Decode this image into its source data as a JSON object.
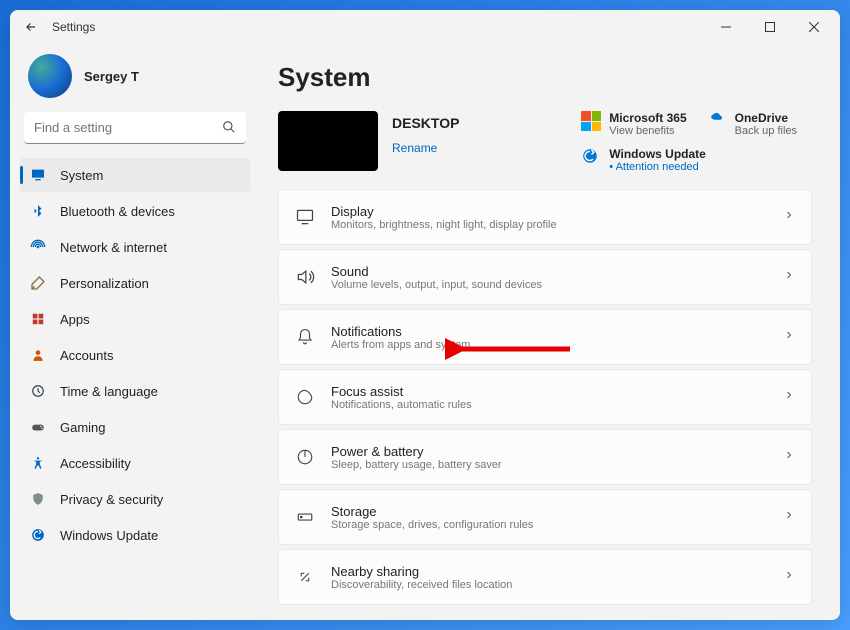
{
  "titlebar": {
    "title": "Settings"
  },
  "user": {
    "name": "Sergey T"
  },
  "search": {
    "placeholder": "Find a setting"
  },
  "sidebar_items": [
    {
      "label": "System",
      "icon": "system",
      "active": true
    },
    {
      "label": "Bluetooth & devices",
      "icon": "bluetooth"
    },
    {
      "label": "Network & internet",
      "icon": "network"
    },
    {
      "label": "Personalization",
      "icon": "personalization"
    },
    {
      "label": "Apps",
      "icon": "apps"
    },
    {
      "label": "Accounts",
      "icon": "accounts"
    },
    {
      "label": "Time & language",
      "icon": "time"
    },
    {
      "label": "Gaming",
      "icon": "gaming"
    },
    {
      "label": "Accessibility",
      "icon": "accessibility"
    },
    {
      "label": "Privacy & security",
      "icon": "privacy"
    },
    {
      "label": "Windows Update",
      "icon": "update"
    }
  ],
  "page": {
    "title": "System"
  },
  "device": {
    "name": "DESKTOP",
    "rename": "Rename"
  },
  "promos": {
    "ms365": {
      "title": "Microsoft 365",
      "sub": "View benefits"
    },
    "onedrive": {
      "title": "OneDrive",
      "sub": "Back up files"
    },
    "update": {
      "title": "Windows Update",
      "sub": "Attention needed"
    }
  },
  "rows": [
    {
      "title": "Display",
      "sub": "Monitors, brightness, night light, display profile",
      "icon": "display"
    },
    {
      "title": "Sound",
      "sub": "Volume levels, output, input, sound devices",
      "icon": "sound"
    },
    {
      "title": "Notifications",
      "sub": "Alerts from apps and system",
      "icon": "notifications"
    },
    {
      "title": "Focus assist",
      "sub": "Notifications, automatic rules",
      "icon": "focus"
    },
    {
      "title": "Power & battery",
      "sub": "Sleep, battery usage, battery saver",
      "icon": "power"
    },
    {
      "title": "Storage",
      "sub": "Storage space, drives, configuration rules",
      "icon": "storage"
    },
    {
      "title": "Nearby sharing",
      "sub": "Discoverability, received files location",
      "icon": "nearby"
    }
  ]
}
